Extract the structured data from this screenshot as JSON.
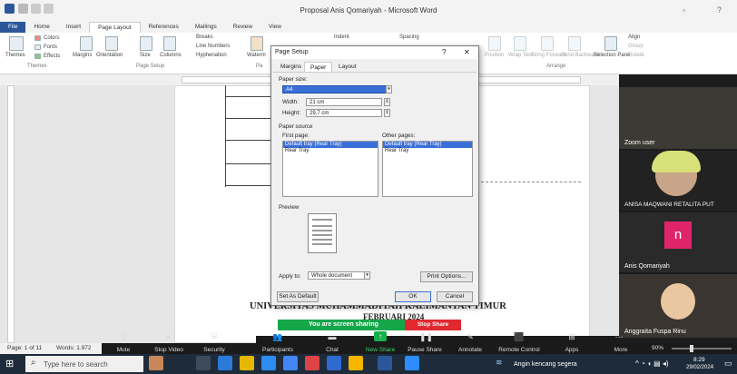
{
  "window": {
    "title": "Proposal Anis Qomariyah - Microsoft Word"
  },
  "ribbon_tabs": [
    "File",
    "Home",
    "Insert",
    "Page Layout",
    "References",
    "Mailings",
    "Review",
    "View"
  ],
  "ribbon": {
    "themes": "Themes",
    "colors": "Colors",
    "fonts": "Fonts",
    "effects": "Effects",
    "margins": "Margins",
    "orientation": "Orientation",
    "size": "Size",
    "columns": "Columns",
    "breaks": "Breaks",
    "line_numbers": "Line Numbers",
    "hyphenation": "Hyphenation",
    "watermark": "Waterm",
    "indent": "Indent",
    "spacing": "Spacing",
    "position": "Position",
    "wrap_text": "Wrap Text",
    "bring_forward": "Bring Forward",
    "send_backward": "Send Backward",
    "selection_pane": "Selection Pane",
    "align": "Align",
    "group": "Group",
    "rotate": "Rotate",
    "group_themes": "Themes",
    "group_page_setup": "Page Setup",
    "group_pa": "Pa",
    "group_arrange": "Arrange"
  },
  "dialog": {
    "title": "Page Setup",
    "help": "?",
    "close": "✕",
    "tabs": [
      "Margins",
      "Paper",
      "Layout"
    ],
    "paper_size_label": "Paper size:",
    "paper_size_value": "A4",
    "width_label": "Width:",
    "width_value": "21 cm",
    "height_label": "Height:",
    "height_value": "29,7 cm",
    "paper_source_label": "Paper source",
    "first_page_label": "First page:",
    "other_pages_label": "Other pages:",
    "first_page_options": [
      "Default tray (Rear Tray)",
      "Rear Tray"
    ],
    "other_pages_options": [
      "Default tray (Rear Tray)",
      "Rear Tray"
    ],
    "preview_label": "Preview",
    "apply_to_label": "Apply to:",
    "apply_to_value": "Whole document",
    "print_options": "Print Options...",
    "set_default": "Set As Default",
    "ok": "OK",
    "cancel": "Cancel"
  },
  "document": {
    "line1": "UNIVERSITAS MUHAMMADIYAH KALIMANTAN TIMUR",
    "line2": "FEBRUARI 2024"
  },
  "zoom": {
    "participants": [
      {
        "name": "Zoom user"
      },
      {
        "name": "ANISA MAQWANI RETALITA PUT"
      },
      {
        "name": "Anis Qomariyah",
        "initial": "n"
      },
      {
        "name": "Anggraita Fuspa Rinu"
      }
    ],
    "share_banner": "You are screen sharing",
    "stop_share": "Stop Share",
    "toolbar": [
      "Mute",
      "Stop Video",
      "Security",
      "Participants",
      "Chat",
      "New Share",
      "Pause Share",
      "Annotate",
      "Remote Control",
      "Apps",
      "More"
    ],
    "participants_count": "6"
  },
  "status": {
    "page": "Page: 1 of 11",
    "words": "Words: 1.972",
    "zoom": "90%"
  },
  "taskbar": {
    "search_placeholder": "Type here to search",
    "weather": "Angin kencang segera",
    "time": "8:29",
    "date": "29/02/2024"
  }
}
